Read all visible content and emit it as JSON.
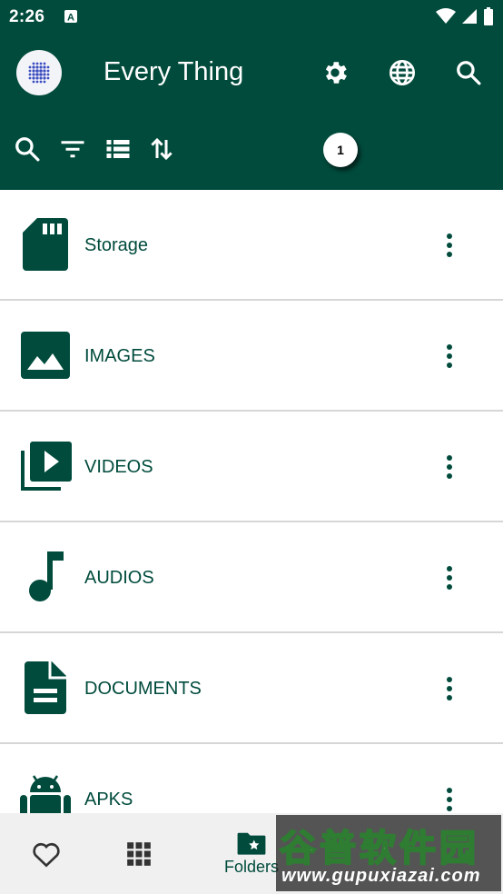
{
  "status_bar": {
    "time": "2:26",
    "notification_icon": "a-letter-icon",
    "icons": [
      "wifi-icon",
      "signal-icon",
      "battery-icon"
    ]
  },
  "app_bar": {
    "title": "Every Thing",
    "actions": [
      "settings-icon",
      "globe-icon",
      "search-icon"
    ],
    "tools": [
      "search-icon",
      "filter-icon",
      "list-view-icon",
      "sort-icon"
    ],
    "badge_count": "1"
  },
  "items": [
    {
      "label": "Storage",
      "icon": "sd-card-icon"
    },
    {
      "label": "IMAGES",
      "icon": "image-icon"
    },
    {
      "label": "VIDEOS",
      "icon": "video-library-icon"
    },
    {
      "label": "AUDIOS",
      "icon": "music-note-icon"
    },
    {
      "label": "DOCUMENTS",
      "icon": "document-icon"
    },
    {
      "label": "APKS",
      "icon": "android-icon"
    }
  ],
  "bottom_nav": {
    "items": [
      {
        "icon": "heart-icon",
        "label": ""
      },
      {
        "icon": "grid-icon",
        "label": ""
      },
      {
        "icon": "folder-star-icon",
        "label": "Folders"
      }
    ]
  },
  "watermark": {
    "line1": "谷普软件园",
    "line2": "www.gupuxiazai.com"
  },
  "colors": {
    "primary": "#004b3c",
    "surface": "#ffffff",
    "divider": "#d6d6d6"
  }
}
